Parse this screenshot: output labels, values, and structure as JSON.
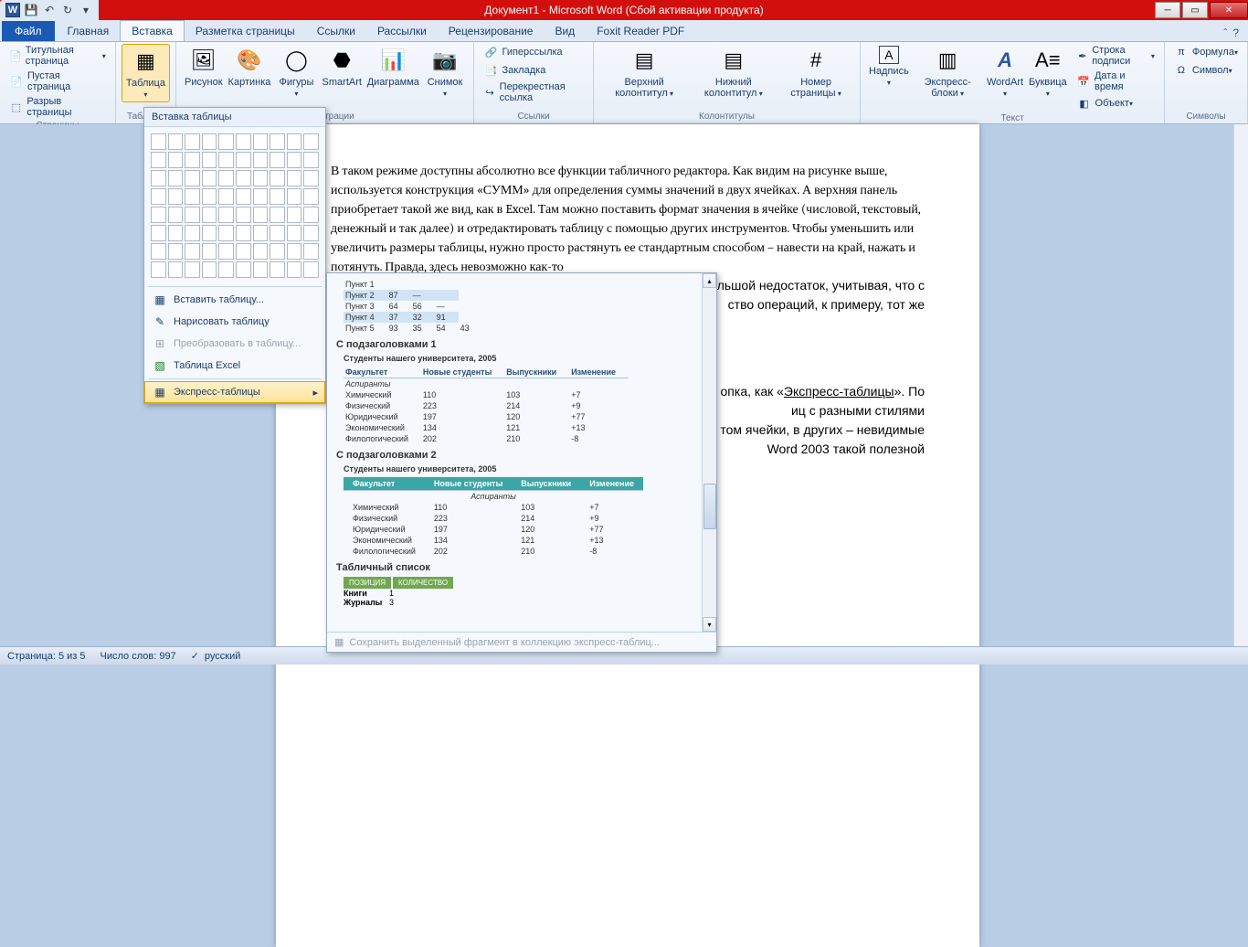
{
  "title": "Документ1 - Microsoft Word (Сбой активации продукта)",
  "qat": {
    "save": "💾",
    "undo": "↶",
    "redo": "↻"
  },
  "tabs": {
    "file": "Файл",
    "home": "Главная",
    "insert": "Вставка",
    "layout": "Разметка страницы",
    "refs": "Ссылки",
    "mail": "Рассылки",
    "review": "Рецензирование",
    "view": "Вид",
    "foxit": "Foxit Reader PDF"
  },
  "ribbon": {
    "pages": {
      "label": "Страницы",
      "cover": "Титульная страница",
      "blank": "Пустая страница",
      "break": "Разрыв страницы"
    },
    "tables": {
      "label": "Таблицы",
      "btn": "Таблица"
    },
    "illus": {
      "label": "Иллюстрации",
      "pic": "Рисунок",
      "clip": "Картинка",
      "shapes": "Фигуры",
      "smart": "SmartArt",
      "chart": "Диаграмма",
      "shot": "Снимок"
    },
    "links": {
      "label": "Ссылки",
      "hyper": "Гиперссылка",
      "book": "Закладка",
      "cross": "Перекрестная ссылка"
    },
    "hf": {
      "label": "Колонтитулы",
      "header": "Верхний колонтитул",
      "footer": "Нижний колонтитул",
      "pnum": "Номер страницы"
    },
    "text": {
      "label": "Текст",
      "tbox": "Надпись",
      "quick": "Экспресс-блоки",
      "wart": "WordArt",
      "drop": "Буквица",
      "sig": "Строка подписи",
      "date": "Дата и время",
      "obj": "Объект"
    },
    "sym": {
      "label": "Символы",
      "eq": "Формула",
      "sym": "Символ"
    }
  },
  "tabledrop": {
    "header": "Вставка таблицы",
    "insert": "Вставить таблицу...",
    "draw": "Нарисовать таблицу",
    "convert": "Преобразовать в таблицу...",
    "excel": "Таблица Excel",
    "express": "Экспресс-таблицы"
  },
  "flyout": {
    "t0rows": [
      [
        "Пункт 1",
        "",
        "",
        ""
      ],
      [
        "Пункт 2",
        "87",
        "—",
        ""
      ],
      [
        "Пункт 3",
        "64",
        "56",
        "—"
      ],
      [
        "Пункт 4",
        "37",
        "32",
        "91"
      ],
      [
        "Пункт 5",
        "93",
        "35",
        "54",
        "43"
      ]
    ],
    "sub1": "С подзаголовками 1",
    "cap": "Студенты нашего университета, 2005",
    "hdr": [
      "Факультет",
      "Новые студенты",
      "Выпускники",
      "Изменение"
    ],
    "asp": "Аспиранты",
    "rows": [
      [
        "Химический",
        "110",
        "103",
        "+7"
      ],
      [
        "Физический",
        "223",
        "214",
        "+9"
      ],
      [
        "Юридический",
        "197",
        "120",
        "+77"
      ],
      [
        "Экономический",
        "134",
        "121",
        "+13"
      ],
      [
        "Филологический",
        "202",
        "210",
        "-8"
      ]
    ],
    "sub2": "С подзаголовками 2",
    "sub3": "Табличный список",
    "thdr": [
      "ПОЗИЦИЯ",
      "КОЛИЧЕСТВО"
    ],
    "trows": [
      [
        "Книги",
        "1"
      ],
      [
        "Журналы",
        "3"
      ]
    ],
    "footer": "Сохранить выделенный фрагмент в коллекцию экспресс-таблиц..."
  },
  "doc": {
    "p1": "В таком режиме доступны абсолютно все функции табличного редактора. Как видим на рисунке выше, используется конструкция «СУММ» для определения суммы значений в двух ячейках. А верхняя панель приобретает такой же вид, как в Excel. Там можно поставить формат значения в ячейке (числовой, текстовый, денежный и так далее) и отредактировать таблицу с помощью других инструментов. Чтобы уменьшить или увеличить размеры таблицы, нужно просто растянуть ее стандартным способом – навести на край, нажать и потянуть. Правда, здесь невозможно как-то",
    "frag1": "льшой недостаток, учитывая, что с",
    "frag2": "ство операций, к примеру, тот же",
    "frag3": "опка, как «",
    "frag3l": "Экспресс-таблицы",
    "frag3b": "». По",
    "frag4": "иц с разными стилями",
    "frag5": "том ячейки, в других – невидимые",
    "frag6": "Word 2003 такой полезной"
  },
  "status": {
    "page": "Страница: 5 из 5",
    "words": "Число слов: 997",
    "lang": "русский"
  }
}
